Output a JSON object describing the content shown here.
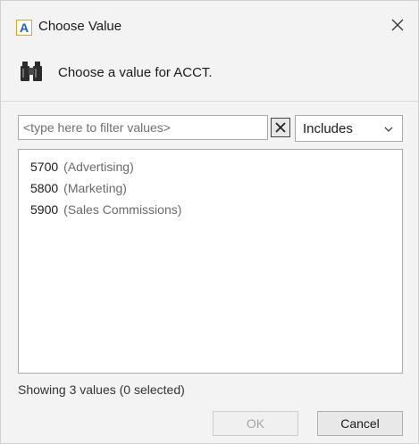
{
  "window": {
    "app_icon_letter": "A",
    "title": "Choose Value",
    "close_icon": "close-icon"
  },
  "header": {
    "icon": "binoculars-icon",
    "prompt": "Choose a value for ACCT."
  },
  "filter": {
    "placeholder": "<type here to filter values>",
    "value": "",
    "clear_icon": "clear-x-icon",
    "mode": "Includes"
  },
  "values": [
    {
      "code": "5700",
      "description": "(Advertising)"
    },
    {
      "code": "5800",
      "description": "(Marketing)"
    },
    {
      "code": "5900",
      "description": "(Sales Commissions)"
    }
  ],
  "status": "Showing 3 values (0 selected)",
  "buttons": {
    "ok": "OK",
    "cancel": "Cancel"
  },
  "colors": {
    "app_icon_border": "#e2a32a",
    "app_icon_letter": "#1f5fbf",
    "disabled_text": "#a6a6a6"
  }
}
